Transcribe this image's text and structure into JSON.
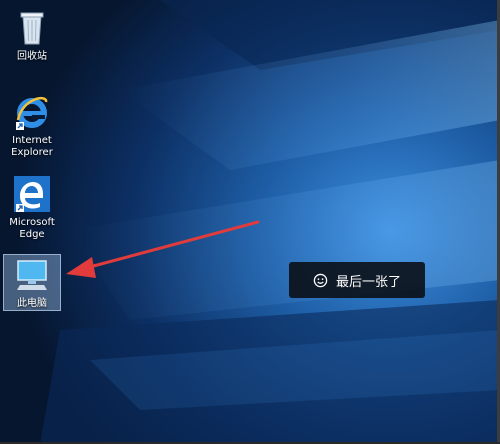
{
  "desktop": {
    "icons": [
      {
        "label": "回收站",
        "icon": "recycle-bin-icon"
      },
      {
        "label": "Internet\nExplorer",
        "icon": "internet-explorer-icon"
      },
      {
        "label": "Microsoft\nEdge",
        "icon": "microsoft-edge-icon"
      },
      {
        "label": "此电脑",
        "icon": "this-pc-icon"
      }
    ],
    "selected_icon": "此电脑"
  },
  "annotation": {
    "arrow_color": "#e23b3b"
  },
  "toast": {
    "icon": "smile-icon",
    "text": "最后一张了"
  },
  "colors": {
    "wallpaper_dark": "#061733",
    "wallpaper_light": "#2f7ecf",
    "toast_bg": "#0b0e14"
  }
}
